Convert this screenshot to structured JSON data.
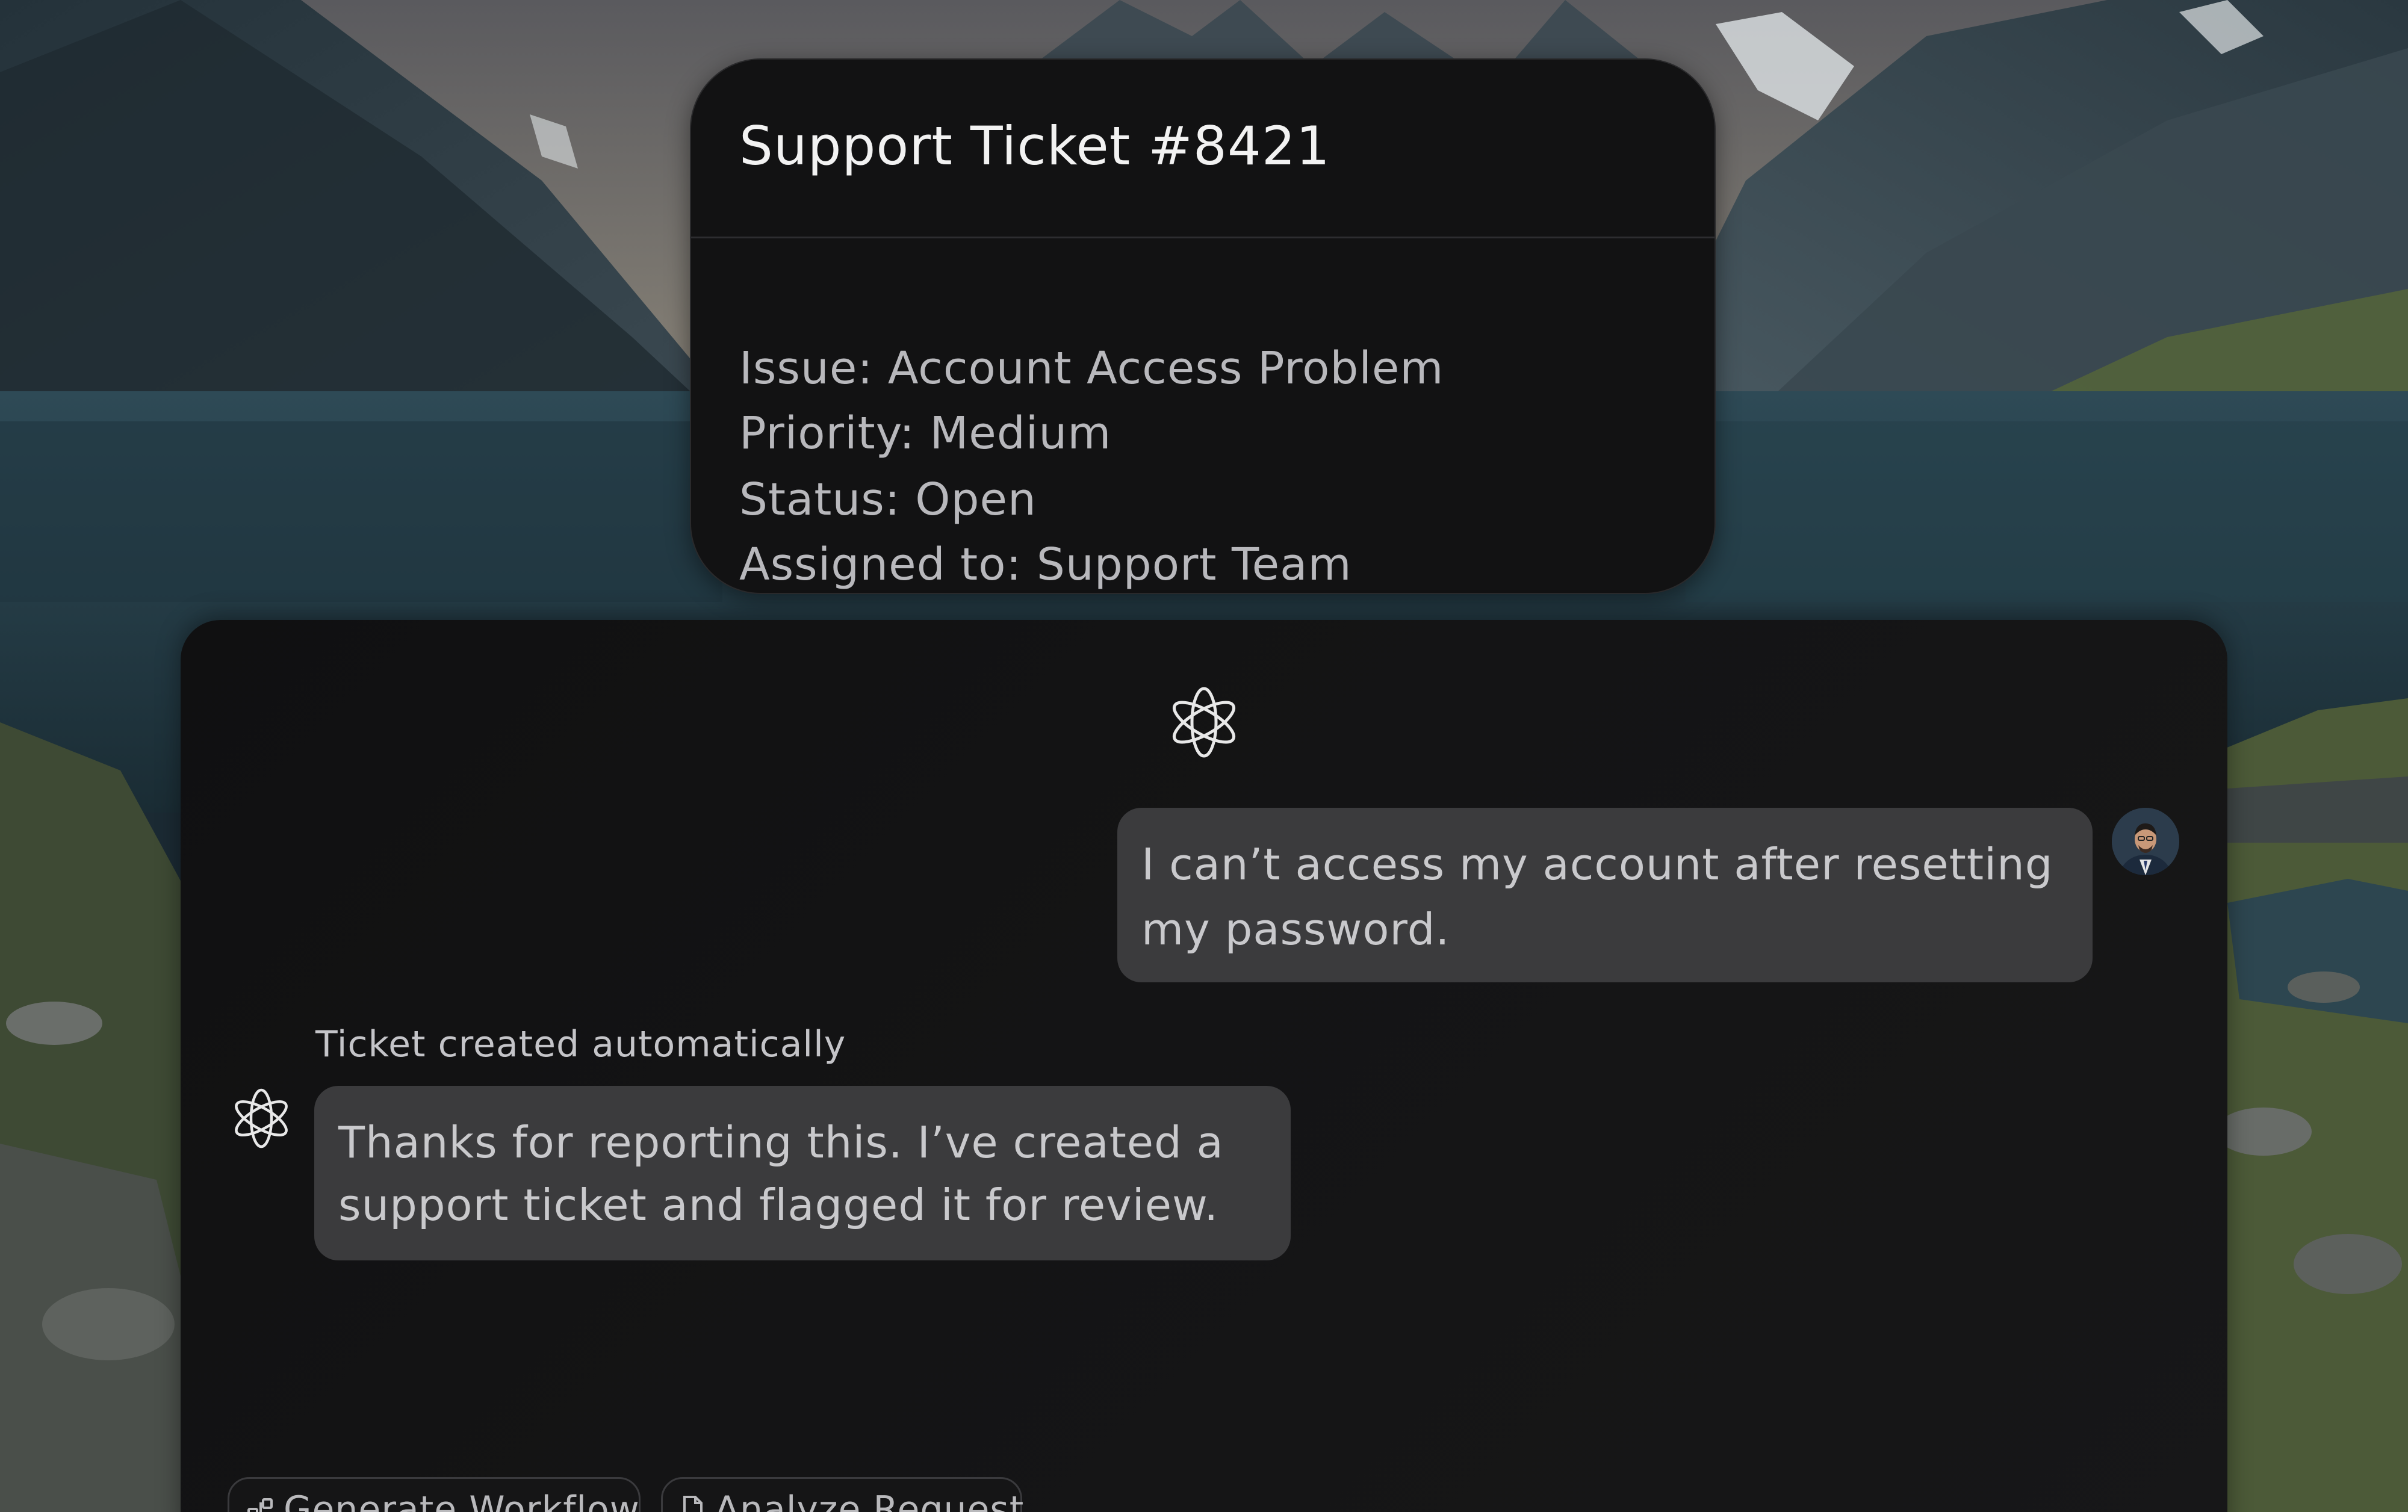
{
  "ticket": {
    "title": "Support Ticket #8421",
    "fields": [
      "Issue: Account Access Problem",
      "Priority: Medium",
      "Status: Open",
      "Assigned to: Support Team"
    ]
  },
  "chat": {
    "user_message": "I can’t access my account after resetting my password.",
    "bot_caption": "Ticket created automatically",
    "bot_message": "Thanks for reporting this. I’ve created a support ticket and flagged it for review.",
    "actions": [
      {
        "label": "Generate Workflow",
        "icon": "workflow-icon"
      },
      {
        "label": "Analyze Request",
        "icon": "document-icon"
      }
    ]
  },
  "icons": {
    "assistant_logo": "atom-logo-icon",
    "user_avatar": "user-avatar"
  },
  "colors": {
    "card_bg": "#121213",
    "panel_bg": "#141415",
    "bubble_bg": "#3b3b3d",
    "title_text": "#f2f2f2",
    "body_text": "#c9c9cc"
  }
}
